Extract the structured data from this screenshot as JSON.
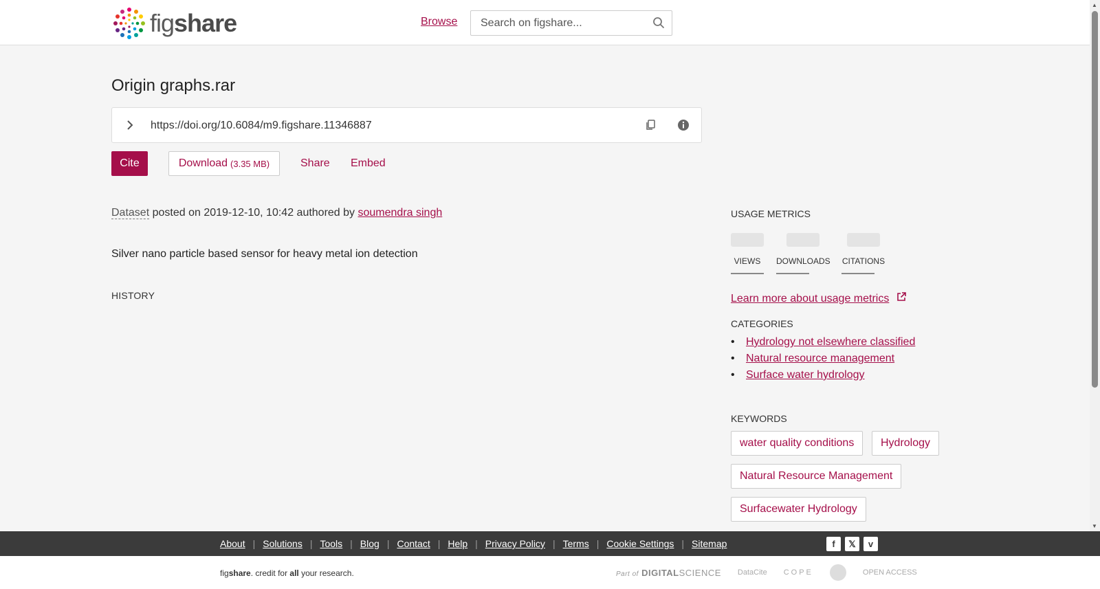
{
  "header": {
    "logo_fig": "fig",
    "logo_share": "share",
    "browse_label": "Browse",
    "search_placeholder": "Search on figshare..."
  },
  "item": {
    "title": "Origin graphs.rar",
    "doi": "https://doi.org/10.6084/m9.figshare.11346887",
    "actions": {
      "cite": "Cite",
      "download": "Download",
      "download_size": "(3.35 MB)",
      "share": "Share",
      "embed": "Embed"
    },
    "type": "Dataset",
    "posted_text": "posted on 2019-12-10, 10:42 authored by",
    "author": "soumendra singh",
    "description": "Silver nano particle based sensor for heavy metal ion detection",
    "history_label": "HISTORY"
  },
  "sidebar": {
    "usage_heading": "USAGE METRICS",
    "metrics": {
      "views": "VIEWS",
      "downloads": "DOWNLOADS",
      "citations": "CITATIONS"
    },
    "learn_more": "Learn more about usage metrics",
    "categories_heading": "CATEGORIES",
    "categories": [
      "Hydrology not elsewhere classified",
      "Natural resource management",
      "Surface water hydrology"
    ],
    "keywords_heading": "KEYWORDS",
    "keywords": [
      "water quality conditions",
      "Hydrology",
      "Natural Resource Management",
      "Surfacewater Hydrology"
    ]
  },
  "footer": {
    "links": [
      "About",
      "Solutions",
      "Tools",
      "Blog",
      "Contact",
      "Help",
      "Privacy Policy",
      "Terms",
      "Cookie Settings",
      "Sitemap"
    ],
    "social_icons": [
      "facebook-icon",
      "x-twitter-icon",
      "vimeo-icon"
    ],
    "tagline_fig": "fig",
    "tagline_share": "share",
    "tagline_mid": ". credit for ",
    "tagline_all": "all",
    "tagline_end": " your research.",
    "partner_part_of": "Part of",
    "partner_ds": "DIGITAL",
    "partner_ds2": "SCIENCE",
    "partner_datacite": "DataCite",
    "partner_cope": "COPE",
    "partner_oa": "OPEN ACCESS"
  },
  "colors": {
    "brand": "#a50f4a",
    "footer": "#3b3b3b"
  }
}
